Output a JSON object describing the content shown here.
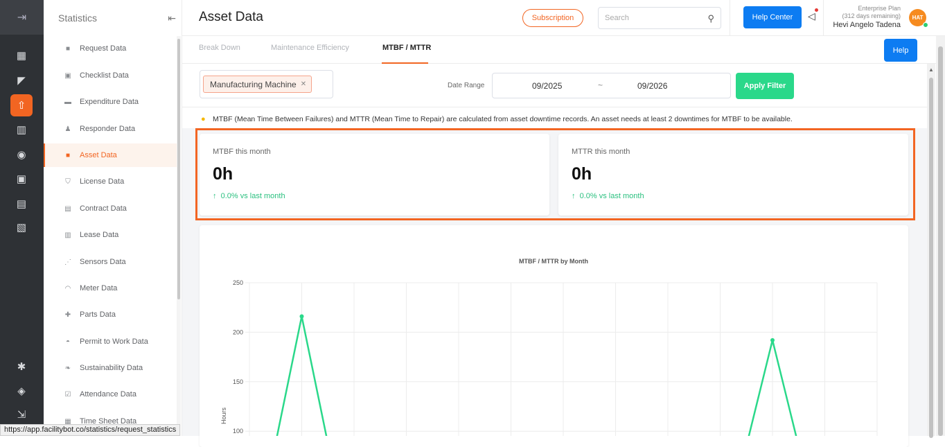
{
  "header": {
    "title": "Asset Data",
    "subscription_label": "Subscription",
    "search_placeholder": "Search",
    "help_center_label": "Help Center",
    "plan_name": "Enterprise Plan",
    "plan_remaining": "(312 days remaining)",
    "user_name": "Hevi Angelo Tadena",
    "avatar_initials": "HAT"
  },
  "sidebar": {
    "title": "Statistics",
    "items": [
      {
        "label": "Request Data",
        "icon": "question-icon"
      },
      {
        "label": "Checklist Data",
        "icon": "checklist-icon"
      },
      {
        "label": "Expenditure Data",
        "icon": "folder-icon"
      },
      {
        "label": "Responder Data",
        "icon": "person-icon"
      },
      {
        "label": "Asset Data",
        "icon": "box-icon",
        "active": true
      },
      {
        "label": "License Data",
        "icon": "shield-icon"
      },
      {
        "label": "Contract Data",
        "icon": "contract-icon"
      },
      {
        "label": "Lease Data",
        "icon": "document-icon"
      },
      {
        "label": "Sensors Data",
        "icon": "signal-icon"
      },
      {
        "label": "Meter Data",
        "icon": "gauge-icon"
      },
      {
        "label": "Parts Data",
        "icon": "puzzle-icon"
      },
      {
        "label": "Permit to Work Data",
        "icon": "helmet-icon"
      },
      {
        "label": "Sustainability Data",
        "icon": "leaf-icon"
      },
      {
        "label": "Attendance Data",
        "icon": "check-square-icon"
      },
      {
        "label": "Time Sheet Data",
        "icon": "timesheet-icon"
      }
    ]
  },
  "tabs": [
    {
      "label": "Break Down"
    },
    {
      "label": "Maintenance Efficiency"
    },
    {
      "label": "MTBF / MTTR",
      "active": true
    }
  ],
  "help_label": "Help",
  "filter": {
    "asset_tag": "Manufacturing Machine",
    "date_range_label": "Date Range",
    "date_from": "09/2025",
    "date_sep": "~",
    "date_to": "09/2026",
    "apply_label": "Apply Filter"
  },
  "note": "MTBF (Mean Time Between Failures) and MTTR (Mean Time to Repair) are calculated from asset downtime records. An asset needs at least 2 downtimes for MTBF to be available.",
  "cards": [
    {
      "label": "MTBF this month",
      "value": "0h",
      "change": "0.0% vs last month"
    },
    {
      "label": "MTTR this month",
      "value": "0h",
      "change": "0.0% vs last month"
    }
  ],
  "status_url": "https://app.facilitybot.co/statistics/request_statistics",
  "colors": {
    "accent": "#f26522",
    "primary": "#0d7cf2",
    "success": "#2ad88a",
    "line": "#2ad88a"
  },
  "chart_data": {
    "type": "line",
    "title": "MTBF / MTTR by Month",
    "xlabel": "",
    "ylabel": "Hours",
    "ylim_visible": [
      100,
      250
    ],
    "yticks": [
      250,
      200,
      150,
      100
    ],
    "series": [
      {
        "values": [
          null,
          216,
          null,
          null,
          null,
          null,
          null,
          null,
          null,
          null,
          192,
          null,
          null
        ]
      }
    ]
  }
}
